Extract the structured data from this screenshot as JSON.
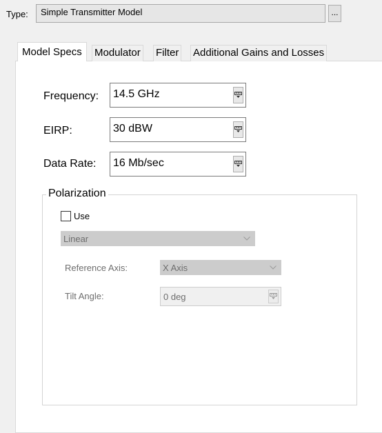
{
  "type_row": {
    "label": "Type:",
    "value": "Simple Transmitter Model",
    "browse_label": "..."
  },
  "tabs": [
    {
      "label": "Model Specs",
      "active": true
    },
    {
      "label": "Modulator",
      "active": false
    },
    {
      "label": "Filter",
      "active": false
    },
    {
      "label": "Additional Gains and Losses",
      "active": false
    }
  ],
  "model_specs": {
    "frequency": {
      "label": "Frequency:",
      "value": "14.5 GHz"
    },
    "eirp": {
      "label": "EIRP:",
      "value": "30 dBW"
    },
    "data_rate": {
      "label": "Data Rate:",
      "value": "16 Mb/sec"
    }
  },
  "polarization": {
    "title": "Polarization",
    "use": {
      "label": "Use",
      "checked": false
    },
    "type_value": "Linear",
    "reference_axis": {
      "label": "Reference Axis:",
      "value": "X Axis"
    },
    "tilt_angle": {
      "label": "Tilt Angle:",
      "value": "0 deg"
    }
  },
  "icons": {
    "spin": "unit-selector-icon",
    "dropdown": "chevron-down-icon"
  },
  "colors": {
    "panel_bg": "#ffffff",
    "window_bg": "#f0f0f0",
    "disabled_fill": "#cccccc",
    "disabled_text": "#6d6d6d"
  }
}
